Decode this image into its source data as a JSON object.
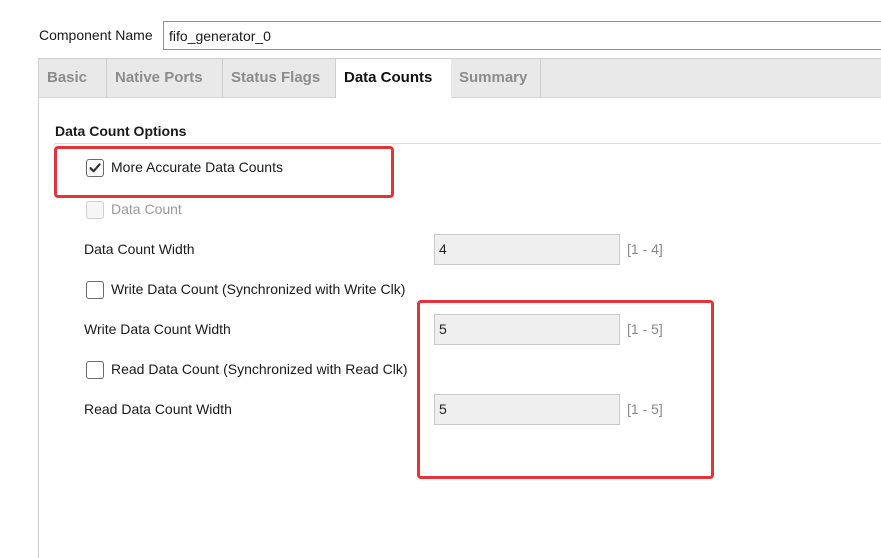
{
  "component": {
    "label": "Component Name",
    "value": "fifo_generator_0"
  },
  "tabs": [
    {
      "label": "Basic",
      "active": false
    },
    {
      "label": "Native Ports",
      "active": false
    },
    {
      "label": "Status Flags",
      "active": false
    },
    {
      "label": "Data Counts",
      "active": true
    },
    {
      "label": "Summary",
      "active": false
    }
  ],
  "section": {
    "title": "Data Count Options"
  },
  "options": {
    "more_accurate": {
      "label": "More Accurate Data Counts",
      "checked": true
    },
    "data_count": {
      "label": "Data Count",
      "checked": false,
      "disabled": true
    },
    "data_count_width": {
      "label": "Data Count Width",
      "value": "4",
      "range": "[1 - 4]"
    },
    "write_data_count": {
      "label": "Write Data Count (Synchronized with Write Clk)",
      "checked": false
    },
    "write_data_count_width": {
      "label": "Write Data Count Width",
      "value": "5",
      "range": "[1 - 5]"
    },
    "read_data_count": {
      "label": "Read Data Count (Synchronized with Read Clk)",
      "checked": false
    },
    "read_data_count_width": {
      "label": "Read Data Count Width",
      "value": "5",
      "range": "[1 - 5]"
    }
  },
  "colors": {
    "highlight": "#e8323a",
    "tab_bar": "#e9e9e9",
    "field_bg": "#efefef"
  }
}
